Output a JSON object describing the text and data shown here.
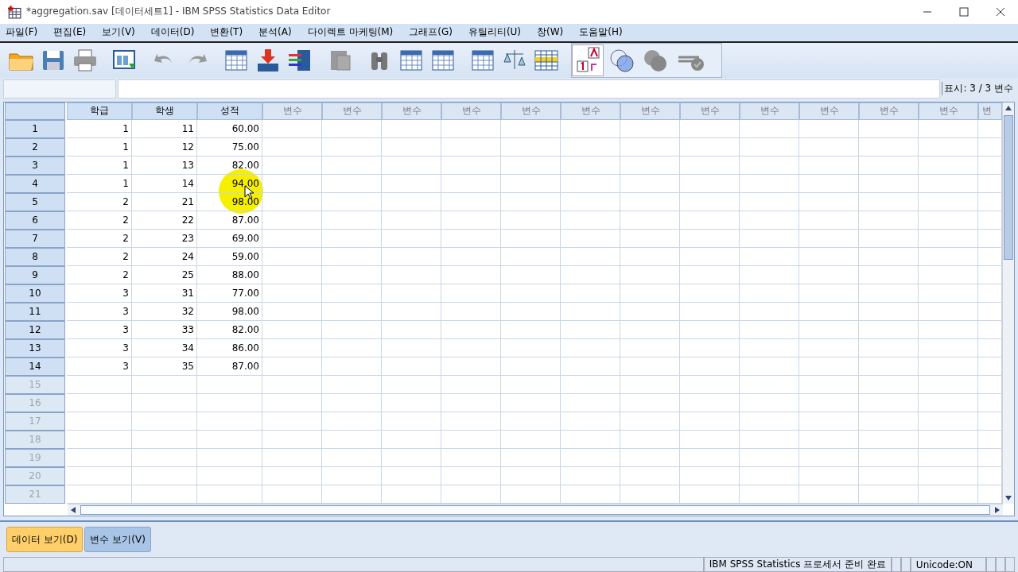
{
  "window": {
    "title": "*aggregation.sav [데이터세트1] - IBM SPSS Statistics Data Editor"
  },
  "menu": [
    "파일(F)",
    "편집(E)",
    "보기(V)",
    "데이터(D)",
    "변환(T)",
    "분석(A)",
    "다이렉트 마케팅(M)",
    "그래프(G)",
    "유틸리티(U)",
    "창(W)",
    "도움말(H)"
  ],
  "variable_count": "표시: 3 / 3 변수",
  "grid": {
    "columns": [
      {
        "label": "학급",
        "defined": true
      },
      {
        "label": "학생",
        "defined": true
      },
      {
        "label": "성적",
        "defined": true
      },
      {
        "label": "변수",
        "defined": false
      },
      {
        "label": "변수",
        "defined": false
      },
      {
        "label": "변수",
        "defined": false
      },
      {
        "label": "변수",
        "defined": false
      },
      {
        "label": "변수",
        "defined": false
      },
      {
        "label": "변수",
        "defined": false
      },
      {
        "label": "변수",
        "defined": false
      },
      {
        "label": "변수",
        "defined": false
      },
      {
        "label": "변수",
        "defined": false
      },
      {
        "label": "변수",
        "defined": false
      },
      {
        "label": "변수",
        "defined": false
      },
      {
        "label": "변수",
        "defined": false
      },
      {
        "label": "변",
        "defined": false
      }
    ],
    "rows": [
      {
        "number": "1",
        "cells": [
          "1",
          "11",
          "60.00"
        ]
      },
      {
        "number": "2",
        "cells": [
          "1",
          "12",
          "75.00"
        ]
      },
      {
        "number": "3",
        "cells": [
          "1",
          "13",
          "82.00"
        ]
      },
      {
        "number": "4",
        "cells": [
          "1",
          "14",
          "94.00"
        ]
      },
      {
        "number": "5",
        "cells": [
          "2",
          "21",
          "98.00"
        ]
      },
      {
        "number": "6",
        "cells": [
          "2",
          "22",
          "87.00"
        ]
      },
      {
        "number": "7",
        "cells": [
          "2",
          "23",
          "69.00"
        ]
      },
      {
        "number": "8",
        "cells": [
          "2",
          "24",
          "59.00"
        ]
      },
      {
        "number": "9",
        "cells": [
          "2",
          "25",
          "88.00"
        ]
      },
      {
        "number": "10",
        "cells": [
          "3",
          "31",
          "77.00"
        ]
      },
      {
        "number": "11",
        "cells": [
          "3",
          "32",
          "98.00"
        ]
      },
      {
        "number": "12",
        "cells": [
          "3",
          "33",
          "82.00"
        ]
      },
      {
        "number": "13",
        "cells": [
          "3",
          "34",
          "86.00"
        ]
      },
      {
        "number": "14",
        "cells": [
          "3",
          "35",
          "87.00"
        ]
      },
      {
        "number": "15",
        "cells": []
      },
      {
        "number": "16",
        "cells": []
      },
      {
        "number": "17",
        "cells": []
      },
      {
        "number": "18",
        "cells": []
      },
      {
        "number": "19",
        "cells": []
      },
      {
        "number": "20",
        "cells": []
      },
      {
        "number": "21",
        "cells": []
      }
    ]
  },
  "tabs": [
    {
      "label": "데이터 보기(D)",
      "selected": true
    },
    {
      "label": "변수 보기(V)",
      "selected": false
    }
  ],
  "status_bar": [
    "IBM SPSS Statistics 프로세서 준비 완료",
    "Unicode:ON"
  ]
}
